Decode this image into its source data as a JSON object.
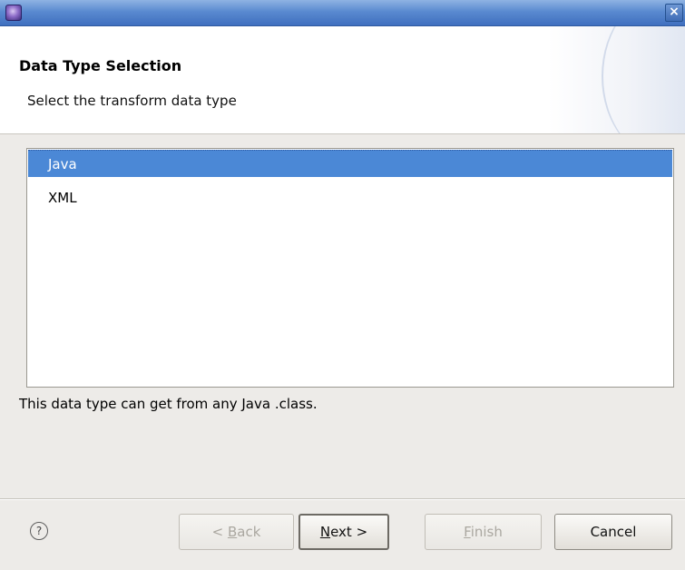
{
  "window": {
    "icon": "eclipse-app-icon",
    "close_glyph": "×"
  },
  "header": {
    "title": "Data Type Selection",
    "description": "Select the transform data type"
  },
  "data_types": {
    "items": [
      {
        "label": "Java",
        "selected": true
      },
      {
        "label": "XML",
        "selected": false
      }
    ]
  },
  "info_text": "This data type can get from any Java .class.",
  "buttons": {
    "help_glyph": "?",
    "back": {
      "prefix": "< ",
      "mnemonic": "B",
      "rest": "ack",
      "enabled": false
    },
    "next": {
      "mnemonic": "N",
      "rest": "ext >",
      "enabled": true
    },
    "finish": {
      "mnemonic": "F",
      "rest": "inish",
      "enabled": false
    },
    "cancel": {
      "label": "Cancel",
      "enabled": true
    }
  },
  "colors": {
    "selection": "#4b88d6",
    "titlebar": "#5a8ad0",
    "dialog_bg": "#edebe8"
  }
}
